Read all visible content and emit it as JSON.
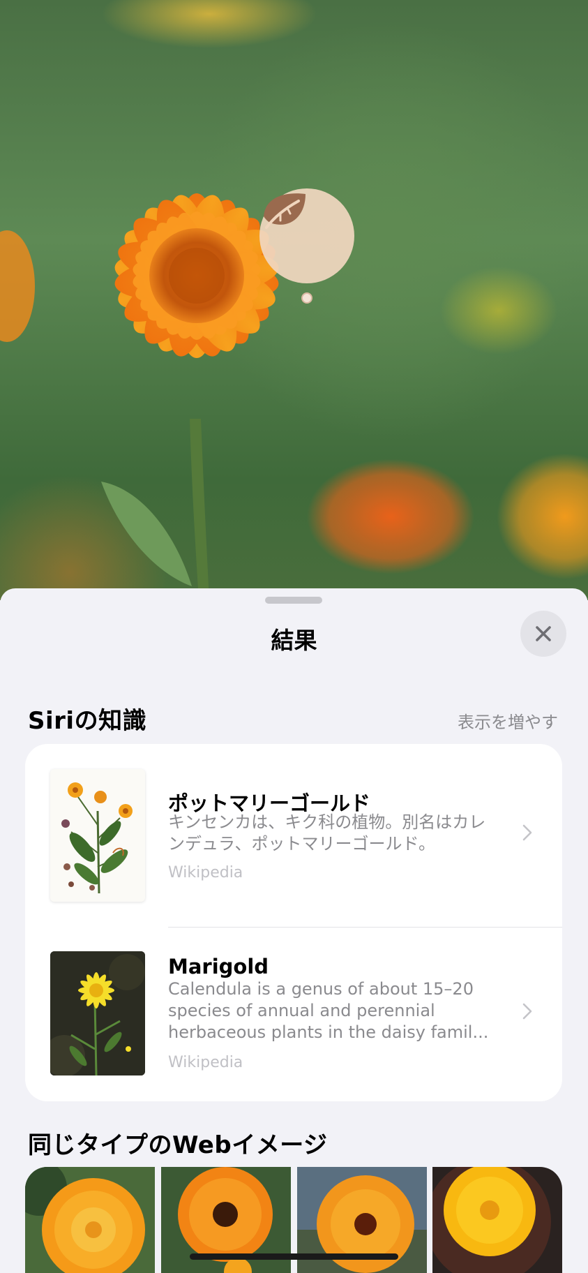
{
  "sheet": {
    "title": "結果",
    "close_icon": "xmark-icon"
  },
  "lookup_pin": {
    "icon": "leaf-icon",
    "color": "#9a6a4e"
  },
  "siri_knowledge": {
    "heading": "Siriの知識",
    "more_label": "表示を増やす",
    "items": [
      {
        "title": "ポットマリーゴールド",
        "description_line1": "キンセンカは、キク科の植物。別名はカレ",
        "description_line2": "ンデュラ、ポットマリーゴールド。",
        "source": "Wikipedia"
      },
      {
        "title": "Marigold",
        "description_line1": "Calendula is a genus of about 15–20",
        "description_line2": "species of annual and perennial",
        "description_line3": "herbaceous plants in the daisy famil...",
        "source": "Wikipedia"
      }
    ]
  },
  "web_images": {
    "heading": "同じタイプのWebイメージ"
  },
  "colors": {
    "background": "#f2f2f7",
    "card": "#ffffff",
    "secondary_text": "#8a8a8e",
    "flower_orange": "#f28a1c"
  }
}
